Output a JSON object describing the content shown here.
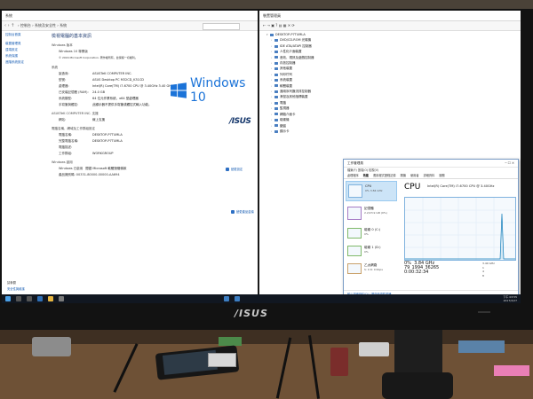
{
  "left_window": {
    "title": "系統",
    "breadcrumb": "› 控制台 › 系統及安全性 › 系統",
    "nav": [
      "控制台首頁",
      "裝置管理員",
      "遠端設定",
      "系統保護",
      "進階系統設定"
    ],
    "heading": "檢視電腦的基本資訊",
    "windows_edition_label": "Windows 版本",
    "windows_edition": "Windows 10 專業版",
    "copyright": "© 2016 Microsoft Corporation. 著作權所有，並保留一切權利。",
    "system_label": "系統",
    "rows_system": [
      {
        "k": "製造商:",
        "v": "ASUSTeK COMPUTER INC."
      },
      {
        "k": "型號:",
        "v": "ASUS Desktop PC M32CD_K31CD"
      },
      {
        "k": "處理器:",
        "v": "Intel(R) Core(TM) i7-6700 CPU @ 3.40GHz 3.40 GHz"
      },
      {
        "k": "已安裝記憶體 (RAM):",
        "v": "24.0 GB"
      },
      {
        "k": "系統類型:",
        "v": "64 位元作業系統，x64 型處理器"
      },
      {
        "k": "手寫筆與觸控:",
        "v": "此顯示器不提供手寫筆或觸控式輸入功能。"
      }
    ],
    "support_label": "ASUSTeK COMPUTER INC. 支援",
    "website_label": "網站:",
    "website_link": "線上支援",
    "computer_label": "電腦名稱、網域及工作群組設定",
    "rows_computer": [
      {
        "k": "電腦名稱:",
        "v": "DESKTOP-P7TUMLA"
      },
      {
        "k": "完整電腦名稱:",
        "v": "DESKTOP-P7TUMLA"
      },
      {
        "k": "電腦描述:",
        "v": ""
      },
      {
        "k": "工作群組:",
        "v": "WORKGROUP"
      }
    ],
    "change_settings": "變更設定",
    "activation_label": "Windows 啟用",
    "activation_text": "Windows 已啟用",
    "activation_link": "閱讀 Microsoft 軟體授權條款",
    "product_id": "產品識別碼: 00331-80000-00000-AA694",
    "change_key": "變更產品金鑰",
    "see_also": "請參閱",
    "see_also_items": [
      "安全性與維護"
    ],
    "logo_text": "Windows 10",
    "asus_logo": "/ISUS"
  },
  "right_window": {
    "title": "裝置管理員",
    "tree": [
      "DESKTOP-P7TUMLA",
      "DVD/CD-ROM 光碟機",
      "IDE ATA/ATAPI 控制器",
      "人性化介面裝置",
      "音效、視訊及遊戲控制器",
      "存放控制器",
      "其他裝置",
      "列印佇列",
      "系統裝置",
      "軟體裝置",
      "通用序列匯流排控制器",
      "滑鼠及其他指標裝置",
      "電腦",
      "監視器",
      "網路介面卡",
      "磁碟機",
      "鍵盤",
      "顯示卡"
    ]
  },
  "task_manager": {
    "title": "工作管理員",
    "menu": "檔案(F)  選項(O)  檢視(V)",
    "tabs": [
      "處理程序",
      "效能",
      "應用程式歷程記錄",
      "開機",
      "使用者",
      "詳細資料",
      "服務"
    ],
    "active_tab_index": 1,
    "side": [
      {
        "name": "CPU",
        "sub": "0% 3.84 GHz"
      },
      {
        "name": "記憶體",
        "sub": "2.2/23.9 GB (9%)"
      },
      {
        "name": "磁碟 0 (C:)",
        "sub": "0%"
      },
      {
        "name": "磁碟 1 (D:)",
        "sub": "0%"
      },
      {
        "name": "乙太網路",
        "sub": "S: 0 R: 0 Kbps"
      }
    ],
    "cpu_label": "CPU",
    "cpu_model": "Intel(R) Core(TM) i7-6700 CPU @ 3.40GHz",
    "stats": {
      "util": "0%",
      "speed": "3.84 GHz",
      "procs": "79",
      "threads": "1994",
      "handles": "36265",
      "uptime": "0:00:32:34",
      "base_speed": "3.40 GHz",
      "sockets": "1",
      "cores": "4",
      "logical": "8"
    },
    "footer": "較少詳細資料(D)  |  開啟資源監視器"
  },
  "taskbar": {
    "time": "下午 03:55",
    "date": "2017/2/27"
  },
  "monitor_brand": "/ISUS"
}
